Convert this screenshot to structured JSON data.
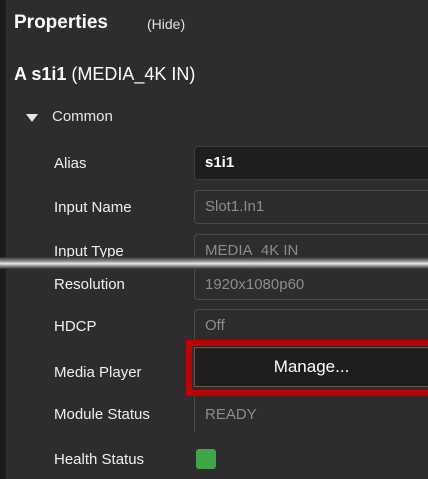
{
  "panel": {
    "title": "Properties",
    "hide_label": "(Hide)",
    "device_name": "A s1i1",
    "device_type": "(MEDIA_4K IN)",
    "group_label": "Common"
  },
  "rows": {
    "alias": {
      "label": "Alias",
      "value": "s1i1"
    },
    "input_name": {
      "label": "Input Name",
      "value": "Slot1.In1"
    },
    "input_type": {
      "label": "Input Type",
      "value": "MEDIA_4K IN"
    },
    "resolution": {
      "label": "Resolution",
      "value": "1920x1080p60"
    },
    "hdcp": {
      "label": "HDCP",
      "value": "Off"
    },
    "media_player": {
      "label": "Media Player",
      "button": "Manage..."
    },
    "module_status": {
      "label": "Module Status",
      "value": "READY"
    },
    "health_status": {
      "label": "Health Status",
      "indicator_color": "#3fa74a"
    }
  },
  "colors": {
    "highlight": "#c00000",
    "panel_bg": "#2d2d2d"
  }
}
